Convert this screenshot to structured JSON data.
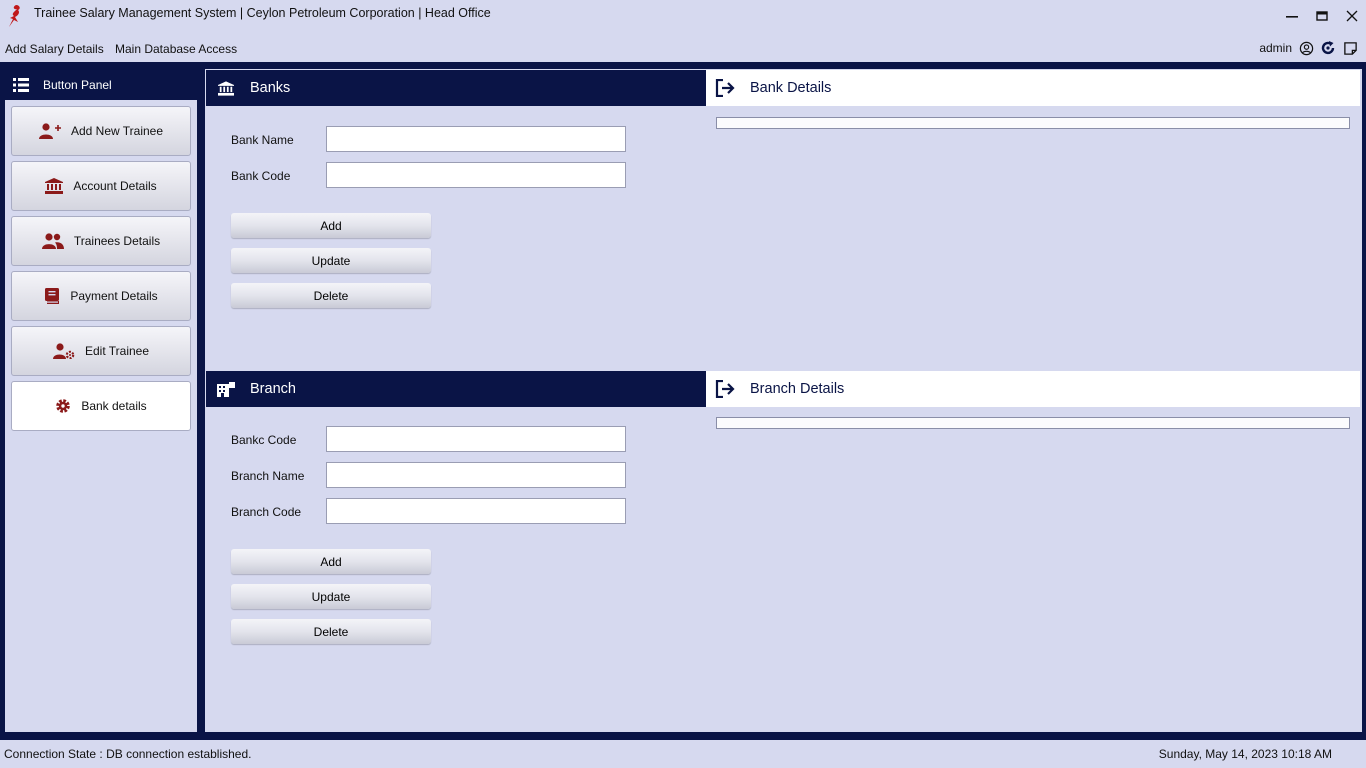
{
  "window": {
    "title": "Trainee Salary Management System | Ceylon Petroleum Corporation | Head Office",
    "controls": [
      "minimize",
      "maximize",
      "close"
    ]
  },
  "menubar": {
    "items": [
      "Add Salary Details",
      "Main Database Access"
    ],
    "user": "admin"
  },
  "sidebar": {
    "title": "Button Panel",
    "items": [
      {
        "label": "Add New Trainee",
        "icon": "add-user-icon"
      },
      {
        "label": "Account Details",
        "icon": "bank-icon"
      },
      {
        "label": "Trainees Details",
        "icon": "users-icon"
      },
      {
        "label": "Payment Details",
        "icon": "book-icon"
      },
      {
        "label": "Edit Trainee",
        "icon": "user-gear-icon"
      },
      {
        "label": "Bank details",
        "icon": "gear-icon",
        "active": true
      }
    ]
  },
  "banks": {
    "title": "Banks",
    "details_title": "Bank Details",
    "fields": [
      {
        "label": "Bank Name",
        "value": ""
      },
      {
        "label": "Bank Code",
        "value": ""
      }
    ],
    "buttons": {
      "add": "Add",
      "update": "Update",
      "delete": "Delete"
    }
  },
  "branch": {
    "title": "Branch",
    "details_title": "Branch Details",
    "fields": [
      {
        "label": "Bankc Code",
        "value": ""
      },
      {
        "label": "Branch Name",
        "value": ""
      },
      {
        "label": "Branch Code",
        "value": ""
      }
    ],
    "buttons": {
      "add": "Add",
      "update": "Update",
      "delete": "Delete"
    }
  },
  "status": {
    "connection": "Connection State : DB connection established.",
    "datetime": "Sunday, May 14, 2023 10:18 AM"
  },
  "colors": {
    "navy": "#0a1446",
    "background": "#d6d9ef",
    "icon_red": "#8b1a1a"
  }
}
